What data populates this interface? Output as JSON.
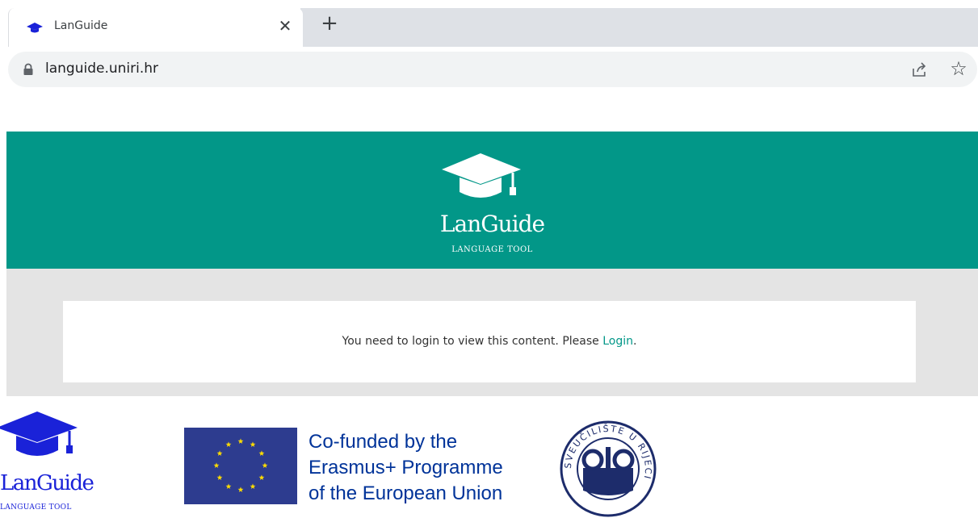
{
  "browser": {
    "tab_title": "LanGuide",
    "tab_close": "✕",
    "new_tab": "+",
    "url": "languide.uniri.hr",
    "bookmark_star": "☆"
  },
  "hero": {
    "brand": "LanGuide",
    "tagline": "LANGUAGE TOOL",
    "color": "#029788"
  },
  "notice": {
    "text": "You need to login to view this content. Please ",
    "link": "Login",
    "suffix": "."
  },
  "footer": {
    "brand": "LanGuide",
    "tagline": "LANGUAGE TOOL",
    "brand_color": "#1a22d8",
    "eu_line1": "Co-funded by the",
    "eu_line2": "Erasmus+ Programme",
    "eu_line3": "of the European Union",
    "seal_text": "SVEUČILIŠTE U RIJECI"
  }
}
